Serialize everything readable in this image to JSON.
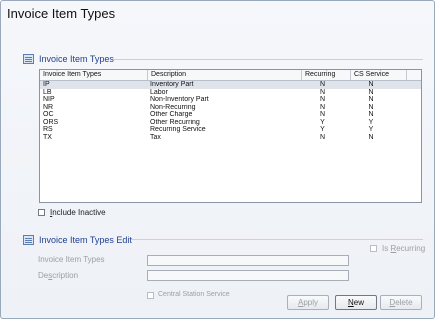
{
  "title": "Invoice Item Types",
  "list_section": {
    "label": "Invoice Item Types"
  },
  "grid": {
    "columns": [
      "Invoice Item Types",
      "Description",
      "Recurring",
      "CS Service"
    ],
    "rows": [
      {
        "code": "IP",
        "description": "Inventory Part",
        "recurring": "N",
        "cs_service": "N"
      },
      {
        "code": "LB",
        "description": "Labor",
        "recurring": "N",
        "cs_service": "N"
      },
      {
        "code": "NIP",
        "description": "Non-Inventory Part",
        "recurring": "N",
        "cs_service": "N"
      },
      {
        "code": "NR",
        "description": "Non-Recurring",
        "recurring": "N",
        "cs_service": "N"
      },
      {
        "code": "OC",
        "description": "Other Charge",
        "recurring": "N",
        "cs_service": "N"
      },
      {
        "code": "ORS",
        "description": "Other Recurring",
        "recurring": "Y",
        "cs_service": "Y"
      },
      {
        "code": "RS",
        "description": "Recurring Service",
        "recurring": "Y",
        "cs_service": "Y"
      },
      {
        "code": "TX",
        "description": "Tax",
        "recurring": "N",
        "cs_service": "N"
      }
    ]
  },
  "include_inactive": {
    "label_prefix": "",
    "label_mnemonic": "I",
    "label_rest": "nclude Inactive",
    "checked": false
  },
  "edit_section": {
    "label": "Invoice Item Types Edit"
  },
  "is_recurring": {
    "label_prefix": "Is ",
    "label_mnemonic": "R",
    "label_rest": "ecurring",
    "checked": false
  },
  "form": {
    "item_type_label": "Invoice Item Types",
    "item_type_value": "",
    "description_label_prefix": "De",
    "description_label_mnemonic": "s",
    "description_label_rest": "cription",
    "description_value": ""
  },
  "central_station": {
    "label": "Central Station Service",
    "checked": false
  },
  "buttons": {
    "apply_mnemonic": "A",
    "apply_rest": "pply",
    "new_mnemonic": "N",
    "new_rest": "ew",
    "delete_mnemonic": "D",
    "delete_rest": "elete"
  }
}
